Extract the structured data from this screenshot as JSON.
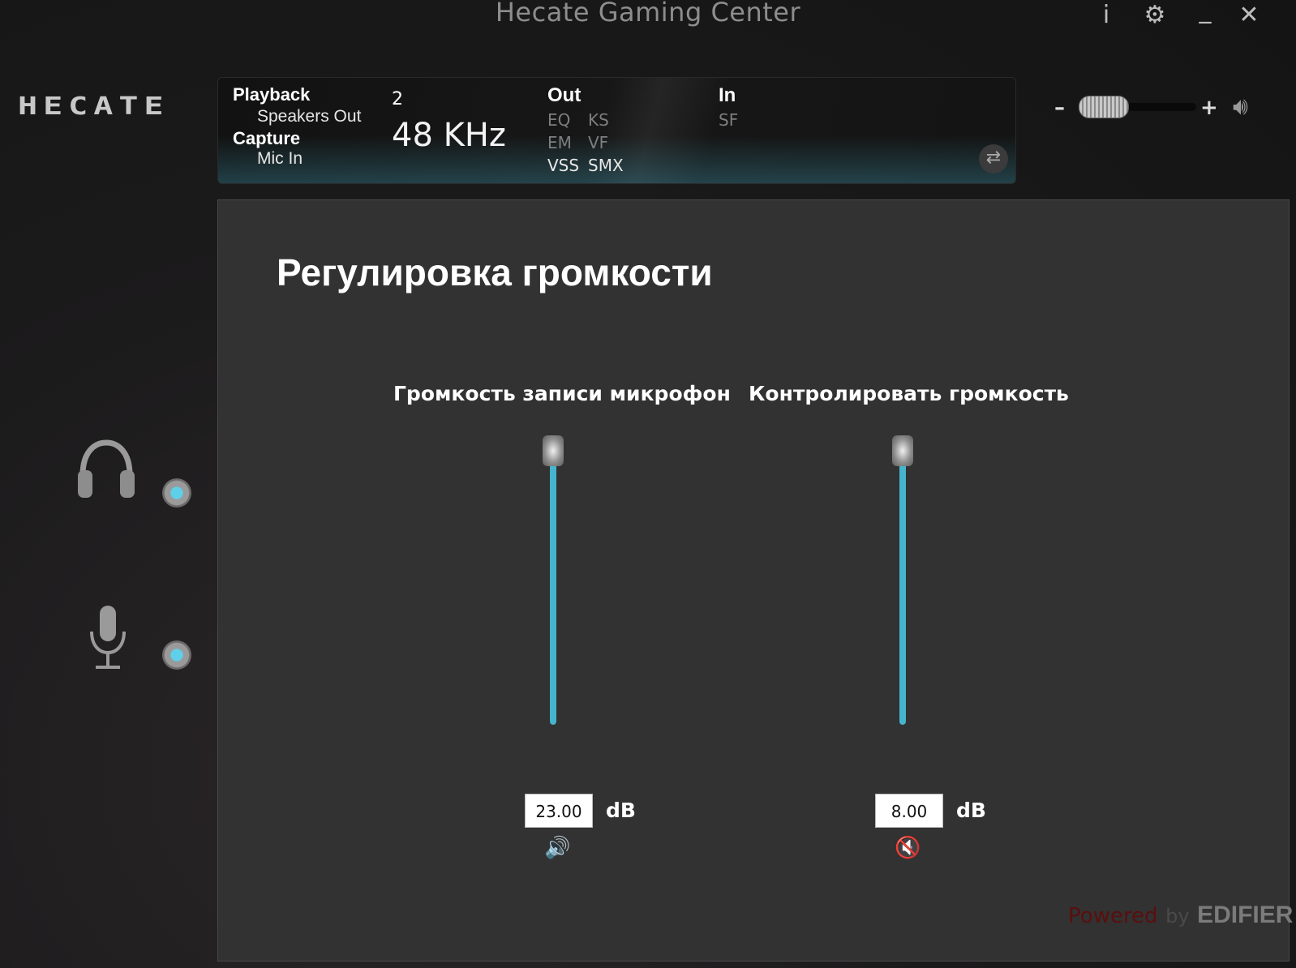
{
  "app": {
    "title": "Hecate Gaming Center",
    "logo_text": "HECATE"
  },
  "window_controls": {
    "info": "i",
    "settings": "⚙",
    "minimize": "_",
    "close": "✕"
  },
  "device_info": {
    "playback_label": "Playback",
    "playback_device": "Speakers Out",
    "capture_label": "Capture",
    "capture_device": "Mic In",
    "channels": "2",
    "sample_rate": "48  KHz",
    "out_label": "Out",
    "in_label": "In",
    "out_effects": [
      "EQ",
      "KS",
      "EM",
      "VF",
      "VSS",
      "SMX"
    ],
    "in_effects": [
      "SF"
    ],
    "active_effects": [
      "VSS",
      "SMX"
    ],
    "swap_icon": "swap-arrows-icon"
  },
  "master_volume": {
    "minus": "–",
    "plus": "+",
    "level": 0.22,
    "icon": "speaker-icon"
  },
  "sidebar": {
    "devices": [
      {
        "name": "headphones",
        "icon": "headphones-icon"
      },
      {
        "name": "microphone",
        "icon": "microphone-icon"
      }
    ]
  },
  "main": {
    "title": "Регулировка громкости",
    "sliders": [
      {
        "label": "Громкость записи микрофон",
        "value": "23.00",
        "unit": "dB",
        "mute_glyph": "🔊",
        "muted": false
      },
      {
        "label": "Контролировать громкость",
        "value": "8.00",
        "unit": "dB",
        "mute_glyph": "🔇",
        "muted": true
      }
    ]
  },
  "footer": {
    "powered": "Powered",
    "by": "by",
    "brand": "EDIFIER"
  },
  "colors": {
    "accent": "#46b4cc",
    "background": "#1c1b1c",
    "panel": "#323232"
  }
}
